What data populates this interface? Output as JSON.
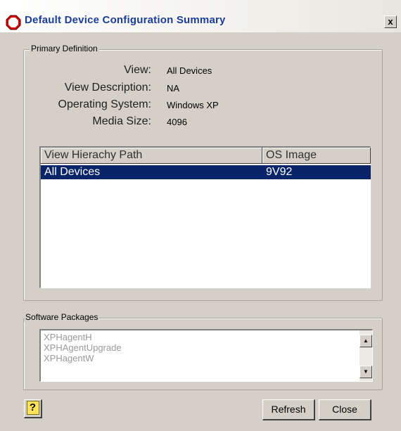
{
  "window": {
    "title": "Default Device Configuration Summary",
    "title_icon": "no-entry-icon",
    "close_label": "x"
  },
  "primary_definition": {
    "group_label": "Primary Definition",
    "fields": [
      {
        "label": "View:",
        "value": "All Devices"
      },
      {
        "label": "View Description:",
        "value": "NA"
      },
      {
        "label": "Operating System:",
        "value": "Windows XP"
      },
      {
        "label": "Media Size:",
        "value": "4096"
      }
    ]
  },
  "hierarchy_list": {
    "columns": [
      "View Hierachy Path",
      "OS Image"
    ],
    "rows": [
      {
        "path": "All Devices",
        "os_image": "9V92",
        "selected": true
      }
    ]
  },
  "software_packages": {
    "group_label": "Software Packages",
    "items": [
      "XPHagentH",
      "XPHAgentUpgrade",
      "XPHagentW"
    ]
  },
  "buttons": {
    "help_icon": "help-question-icon",
    "help_glyph": "?",
    "refresh_label": "Refresh",
    "close_label": "Close"
  },
  "colors": {
    "selection": "#0a246a",
    "title_text": "#1a3d9a",
    "dialog_bg": "#d4d0c8"
  }
}
